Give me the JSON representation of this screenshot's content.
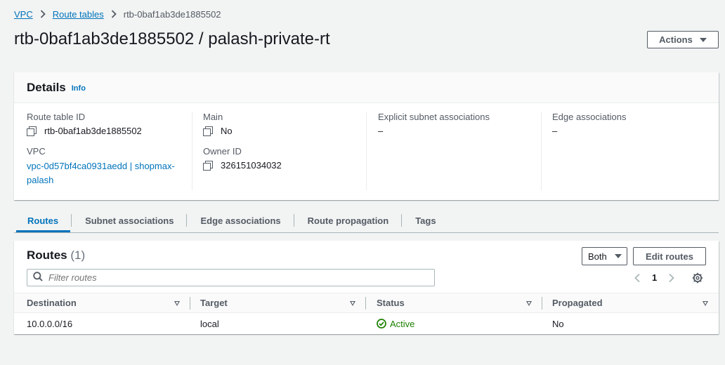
{
  "breadcrumb": {
    "vpc": "VPC",
    "route_tables": "Route tables",
    "current": "rtb-0baf1ab3de1885502"
  },
  "page": {
    "title": "rtb-0baf1ab3de1885502 / palash-private-rt",
    "actions_label": "Actions"
  },
  "details": {
    "heading": "Details",
    "info": "Info",
    "route_table_id_label": "Route table ID",
    "route_table_id": "rtb-0baf1ab3de1885502",
    "vpc_label": "VPC",
    "vpc_line1": "vpc-0d57bf4ca0931aedd | shopmax-",
    "vpc_line2": "palash",
    "main_label": "Main",
    "main_value": "No",
    "owner_label": "Owner ID",
    "owner_value": "326151034032",
    "explicit_label": "Explicit subnet associations",
    "explicit_value": "–",
    "edge_label": "Edge associations",
    "edge_value": "–"
  },
  "tabs": [
    "Routes",
    "Subnet associations",
    "Edge associations",
    "Route propagation",
    "Tags"
  ],
  "routes": {
    "heading": "Routes",
    "count": "(1)",
    "filter_value": "Both",
    "edit_label": "Edit routes",
    "search_placeholder": "Filter routes",
    "page_number": "1",
    "columns": [
      "Destination",
      "Target",
      "Status",
      "Propagated"
    ],
    "rows": [
      {
        "destination": "10.0.0.0/16",
        "target": "local",
        "status": "Active",
        "propagated": "No"
      }
    ]
  },
  "colors": {
    "link": "#0073bb",
    "success": "#1d8102",
    "text": "#16191f",
    "muted": "#545b64"
  },
  "icons": [
    "chevron-right-icon",
    "caret-down-icon",
    "copy-icon",
    "search-icon",
    "chevron-left-icon",
    "settings-gear-icon",
    "sort-icon",
    "check-circle-icon"
  ]
}
